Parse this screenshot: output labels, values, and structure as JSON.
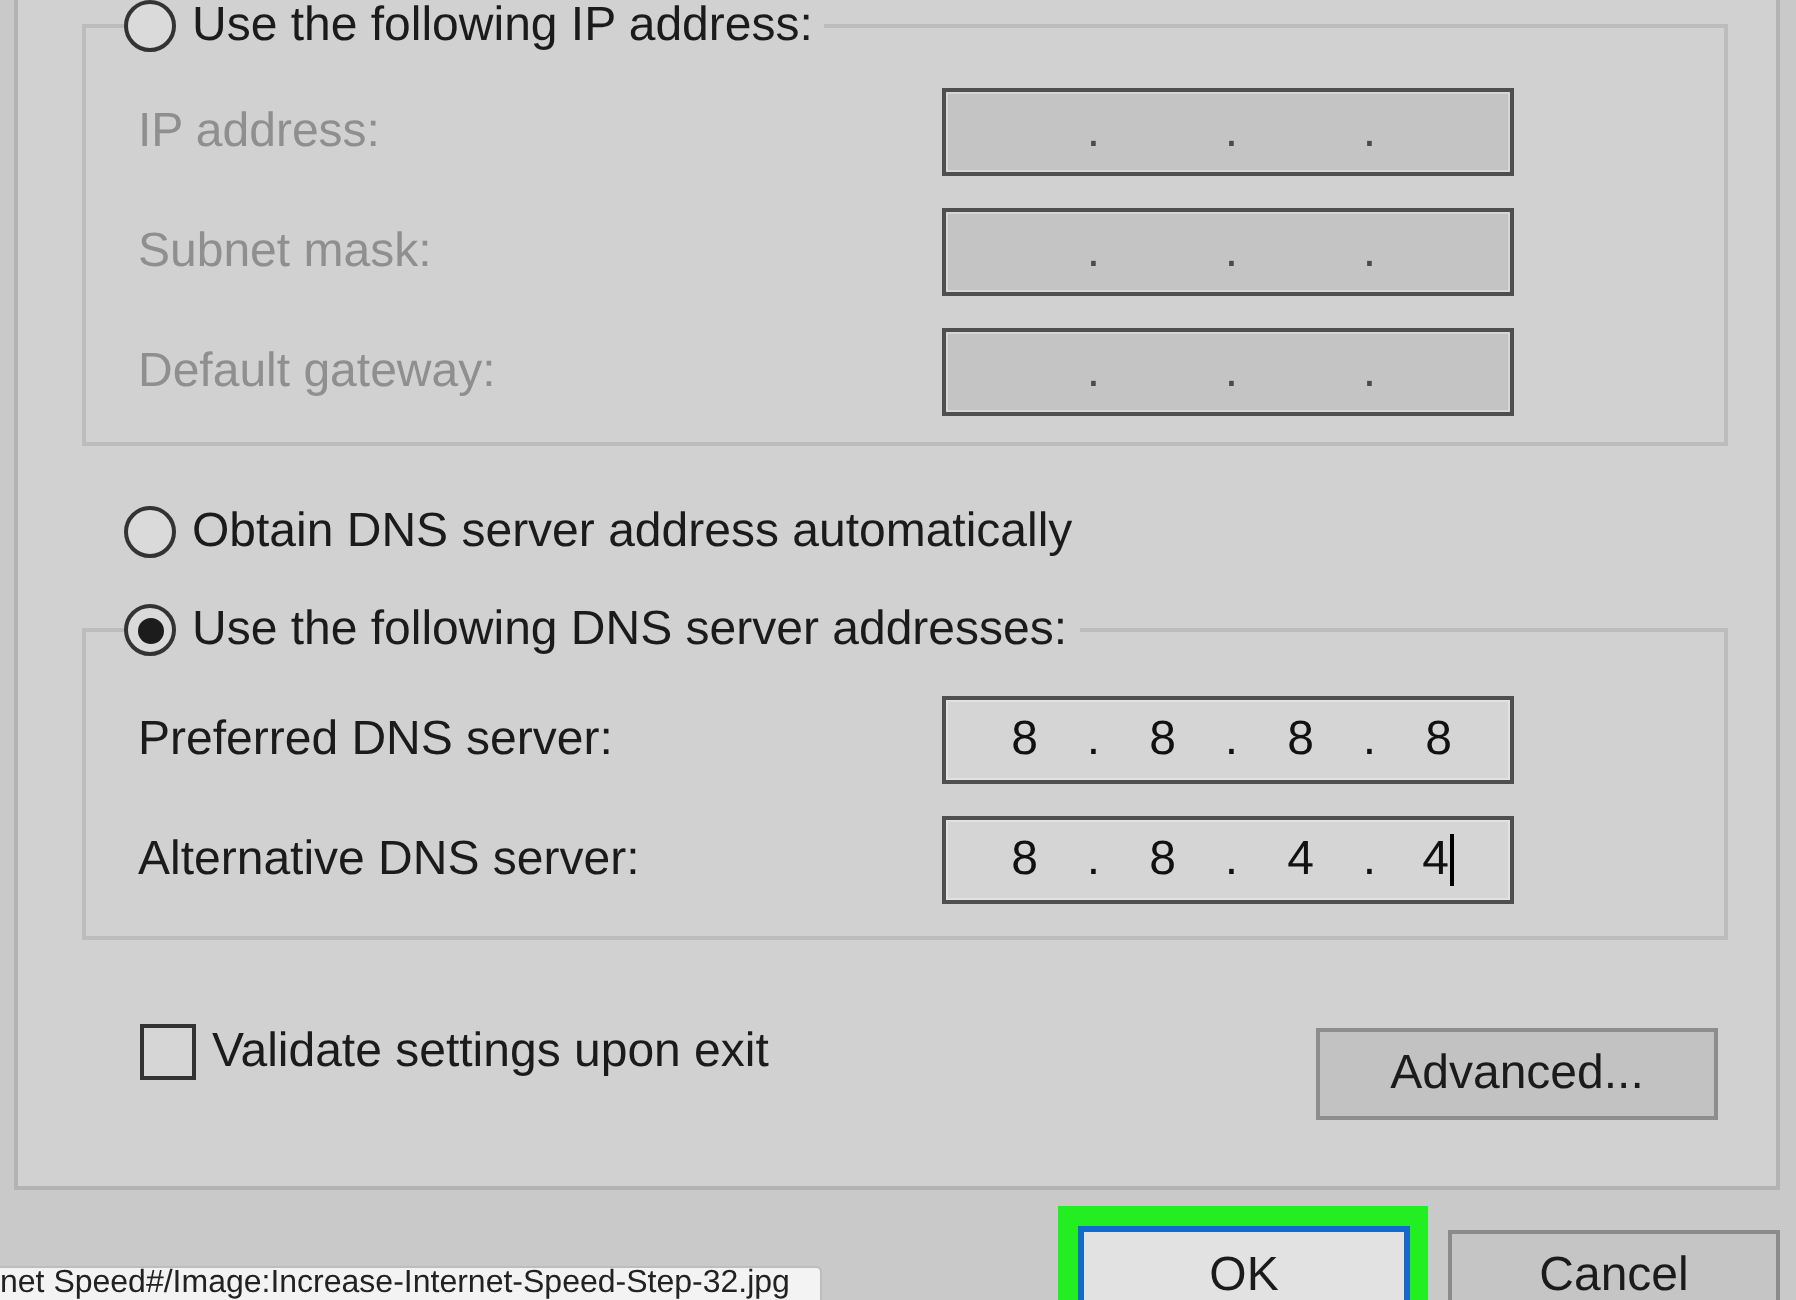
{
  "ip_group": {
    "mode_radio": {
      "label": "Use the following IP address:",
      "selected": false
    },
    "disabled": true,
    "fields": [
      {
        "label": "IP address:",
        "value": ". . .",
        "focused": false
      },
      {
        "label": "Subnet mask:",
        "value": ". . .",
        "focused": false
      },
      {
        "label": "Default gateway:",
        "value": ". . .",
        "focused": false
      }
    ]
  },
  "dns_auto_radio": {
    "label": "Obtain DNS server address automatically",
    "selected": false
  },
  "dns_group": {
    "mode_radio": {
      "label": "Use the following DNS server addresses:",
      "selected": true
    },
    "disabled": false,
    "fields": [
      {
        "label": "Preferred DNS server:",
        "value": "8 . 8 . 8 . 8",
        "focused": false
      },
      {
        "label": "Alternative DNS server:",
        "value": "8 . 8 . 4 . 4",
        "focused": true
      }
    ]
  },
  "validate_checkbox": {
    "label": "Validate settings upon exit",
    "checked": false
  },
  "advanced_button": {
    "label": "Advanced..."
  },
  "dialog_buttons": [
    {
      "label": "OK",
      "default": true,
      "highlighted": true
    },
    {
      "label": "Cancel",
      "default": false,
      "highlighted": false
    }
  ],
  "status_tooltip": {
    "text": "net Speed#/Image:Increase-Internet-Speed-Step-32.jpg"
  }
}
